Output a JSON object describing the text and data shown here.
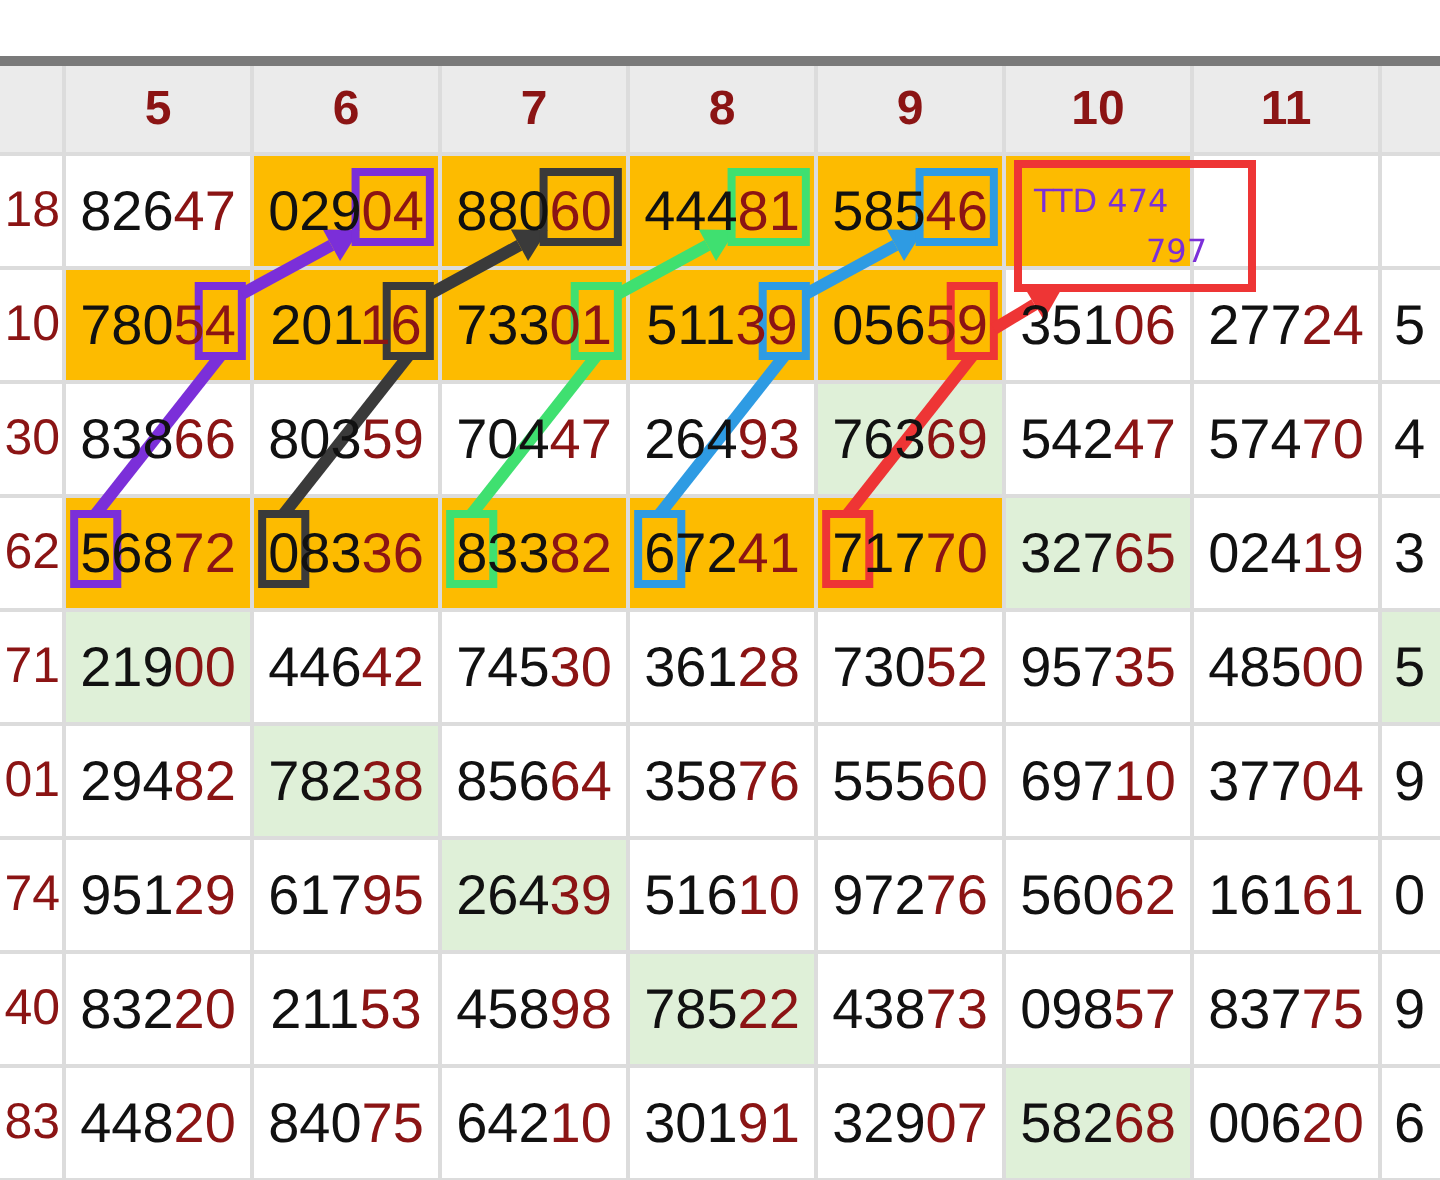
{
  "columns": [
    "5",
    "6",
    "7",
    "8",
    "9",
    "10",
    "11"
  ],
  "rows": [
    {
      "lead": "18",
      "cells": [
        {
          "value": "82647",
          "marked": false,
          "matched": false
        },
        {
          "value": "02904",
          "marked": true,
          "matched": false
        },
        {
          "value": "88060",
          "marked": true,
          "matched": false
        },
        {
          "value": "44481",
          "marked": true,
          "matched": false
        },
        {
          "value": "58546",
          "marked": true,
          "matched": false
        },
        {
          "marked": true,
          "matched": false
        },
        {
          "marked": false,
          "matched": false
        }
      ]
    },
    {
      "lead": "10",
      "cells": [
        {
          "value": "78054",
          "marked": true,
          "matched": false
        },
        {
          "value": "20116",
          "marked": true,
          "matched": false
        },
        {
          "value": "73301",
          "marked": true,
          "matched": false
        },
        {
          "value": "51139",
          "marked": true,
          "matched": false
        },
        {
          "value": "05659",
          "marked": true,
          "matched": false
        },
        {
          "value": "35106",
          "marked": false,
          "matched": false
        },
        {
          "value": "27724",
          "marked": false,
          "matched": false
        }
      ],
      "trail": {
        "value": "5",
        "matched": false
      }
    },
    {
      "lead": "30",
      "cells": [
        {
          "value": "83866",
          "marked": false,
          "matched": false
        },
        {
          "value": "80359",
          "marked": false,
          "matched": false
        },
        {
          "value": "70447",
          "marked": false,
          "matched": false
        },
        {
          "value": "26493",
          "marked": false,
          "matched": false
        },
        {
          "value": "76369",
          "marked": false,
          "matched": true
        },
        {
          "value": "54247",
          "marked": false,
          "matched": false
        },
        {
          "value": "57470",
          "marked": false,
          "matched": false
        }
      ],
      "trail": {
        "value": "4",
        "matched": false
      }
    },
    {
      "lead": "62",
      "cells": [
        {
          "value": "56872",
          "marked": true,
          "matched": false
        },
        {
          "value": "08336",
          "marked": true,
          "matched": false
        },
        {
          "value": "83382",
          "marked": true,
          "matched": false
        },
        {
          "value": "67241",
          "marked": true,
          "matched": false
        },
        {
          "value": "71770",
          "marked": true,
          "matched": false
        },
        {
          "value": "32765",
          "marked": false,
          "matched": true
        },
        {
          "value": "02419",
          "marked": false,
          "matched": false
        }
      ],
      "trail": {
        "value": "3",
        "matched": false
      }
    },
    {
      "lead": "71",
      "cells": [
        {
          "value": "21900",
          "marked": false,
          "matched": true
        },
        {
          "value": "44642",
          "marked": false,
          "matched": false
        },
        {
          "value": "74530",
          "marked": false,
          "matched": false
        },
        {
          "value": "36128",
          "marked": false,
          "matched": false
        },
        {
          "value": "73052",
          "marked": false,
          "matched": false
        },
        {
          "value": "95735",
          "marked": false,
          "matched": false
        },
        {
          "value": "48500",
          "marked": false,
          "matched": false
        }
      ],
      "trail": {
        "value": "5",
        "matched": true
      }
    },
    {
      "lead": "01",
      "cells": [
        {
          "value": "29482",
          "marked": false,
          "matched": false
        },
        {
          "value": "78238",
          "marked": false,
          "matched": true
        },
        {
          "value": "85664",
          "marked": false,
          "matched": false
        },
        {
          "value": "35876",
          "marked": false,
          "matched": false
        },
        {
          "value": "55560",
          "marked": false,
          "matched": false
        },
        {
          "value": "69710",
          "marked": false,
          "matched": false
        },
        {
          "value": "37704",
          "marked": false,
          "matched": false
        }
      ],
      "trail": {
        "value": "9",
        "matched": false
      }
    },
    {
      "lead": "74",
      "cells": [
        {
          "value": "95129",
          "marked": false,
          "matched": false
        },
        {
          "value": "61795",
          "marked": false,
          "matched": false
        },
        {
          "value": "26439",
          "marked": false,
          "matched": true
        },
        {
          "value": "51610",
          "marked": false,
          "matched": false
        },
        {
          "value": "97276",
          "marked": false,
          "matched": false
        },
        {
          "value": "56062",
          "marked": false,
          "matched": false
        },
        {
          "value": "16161",
          "marked": false,
          "matched": false
        }
      ],
      "trail": {
        "value": "0",
        "matched": false
      }
    },
    {
      "lead": "40",
      "cells": [
        {
          "value": "83220",
          "marked": false,
          "matched": false
        },
        {
          "value": "21153",
          "marked": false,
          "matched": false
        },
        {
          "value": "45898",
          "marked": false,
          "matched": false
        },
        {
          "value": "78522",
          "marked": false,
          "matched": true
        },
        {
          "value": "43873",
          "marked": false,
          "matched": false
        },
        {
          "value": "09857",
          "marked": false,
          "matched": false
        },
        {
          "value": "83775",
          "marked": false,
          "matched": false
        }
      ],
      "trail": {
        "value": "9",
        "matched": false
      }
    },
    {
      "lead": "83",
      "cells": [
        {
          "value": "44820",
          "marked": false,
          "matched": false
        },
        {
          "value": "84075",
          "marked": false,
          "matched": false
        },
        {
          "value": "64210",
          "marked": false,
          "matched": false
        },
        {
          "value": "30191",
          "marked": false,
          "matched": false
        },
        {
          "value": "32907",
          "marked": false,
          "matched": false
        },
        {
          "value": "58268",
          "marked": false,
          "matched": true
        },
        {
          "value": "00620",
          "marked": false,
          "matched": false
        }
      ],
      "trail": {
        "value": "6",
        "matched": false
      }
    }
  ],
  "annotations": [
    {
      "kind": "digit",
      "color": "#7b2fd9"
    },
    {
      "kind": "digit",
      "color": "#3a3a3a"
    },
    {
      "kind": "digit",
      "color": "#3fe070"
    },
    {
      "kind": "digit",
      "color": "#2e9be3"
    },
    {
      "kind": "note",
      "color": "#ee3535",
      "note": [
        "TTD 474",
        "797"
      ]
    }
  ]
}
